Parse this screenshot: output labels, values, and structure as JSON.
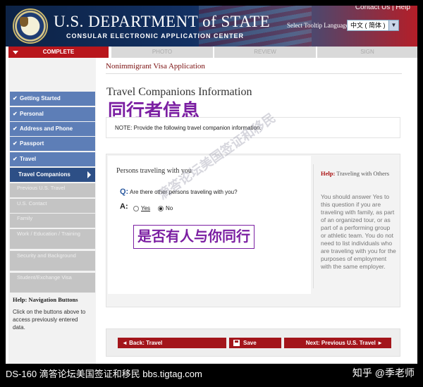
{
  "header": {
    "title": "U.S. DEPARTMENT of STATE",
    "subtitle": "CONSULAR ELECTRONIC APPLICATION CENTER",
    "top_links": "Contact Us  |  Help",
    "language_label": "Select Tooltip Language",
    "language_value": "中文 ( 简体 )"
  },
  "steps": {
    "complete": "COMPLETE",
    "photo": "PHOTO",
    "review": "REVIEW",
    "sign": "SIGN"
  },
  "sidebar": {
    "completed": [
      "Getting Started",
      "Personal",
      "Address and Phone",
      "Passport",
      "Travel"
    ],
    "active": "Travel Companions",
    "future": [
      "Previous U.S. Travel",
      "U.S. Contact",
      "Family",
      "Work / Education / Training",
      "Security and Background",
      "Student/Exchange Visa"
    ],
    "help_title": "Help: Navigation Buttons",
    "help_text": "Click on the buttons above to access previously entered data."
  },
  "main": {
    "app_title": "Nonimmigrant Visa Application",
    "page_title": "Travel Companions Information",
    "cn_title": "同行者信息",
    "note": "NOTE: Provide the following travel companion information.",
    "section_heading": "Persons traveling with you",
    "q_label": "Q:",
    "question": "Are there other persons traveling with you?",
    "a_label": "A:",
    "options": [
      "Yes",
      "No"
    ],
    "selected": "No",
    "cn_question": "是否有人与你同行"
  },
  "help": {
    "title_prefix": "Help:",
    "title": "Traveling with Others",
    "text": "You should answer Yes to this question if you are traveling with family, as part of an organized tour, or as part of a performing group or athletic team. You do not need to list individuals who are traveling with you for the purposes of employment with the same employer."
  },
  "buttons": {
    "back": "◄ Back: Travel",
    "save": "Save",
    "next": "Next: Previous U.S. Travel ►"
  },
  "watermark": "滴答论坛美国签证和移民",
  "footer": {
    "left": "DS-160  滴答论坛美国签证和移民  bbs.tigtag.com",
    "right": "知乎 @季老师"
  },
  "colors": {
    "header_blue": "#0d2346",
    "accent_red": "#a3151b",
    "nav_done": "#5d7eb7",
    "nav_active": "#2d4f86",
    "annotation_purple": "#7b1fa2"
  }
}
